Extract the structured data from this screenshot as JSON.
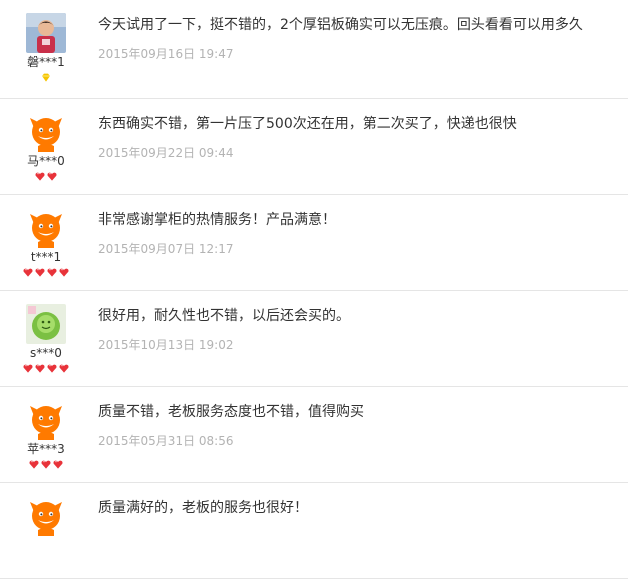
{
  "reviews": [
    {
      "user": "磐***1",
      "avatar": "photo-child-avatar",
      "text": "今天试用了一下，挺不错的，2个厚铝板确实可以无压痕。回头看看可以用多久",
      "date": "2015年09月16日 19:47",
      "badge_type": "diamond",
      "badge_count": 1,
      "badge_color": "#f5c400"
    },
    {
      "user": "马***0",
      "avatar": "taobao-mascot-avatar",
      "text": "东西确实不错，第一片压了500次还在用，第二次买了，快递也很快",
      "date": "2015年09月22日 09:44",
      "badge_type": "heart",
      "badge_count": 2,
      "badge_color": "#e8333a"
    },
    {
      "user": "t***1",
      "avatar": "taobao-mascot-avatar",
      "text": "非常感谢掌柜的热情服务！产品满意！",
      "date": "2015年09月07日 12:17",
      "badge_type": "heart",
      "badge_count": 4,
      "badge_color": "#e8333a"
    },
    {
      "user": "s***0",
      "avatar": "photo-green-avatar",
      "text": "很好用，耐久性也不错，以后还会买的。",
      "date": "2015年10月13日 19:02",
      "badge_type": "heart",
      "badge_count": 4,
      "badge_color": "#e8333a"
    },
    {
      "user": "苹***3",
      "avatar": "taobao-mascot-avatar",
      "text": "质量不错，老板服务态度也不错，值得购买",
      "date": "2015年05月31日 08:56",
      "badge_type": "heart",
      "badge_count": 3,
      "badge_color": "#e8333a"
    },
    {
      "user": "",
      "avatar": "taobao-mascot-avatar",
      "text": "质量满好的，老板的服务也很好！",
      "date": "",
      "badge_type": "heart",
      "badge_count": 0,
      "badge_color": "#e8333a"
    }
  ]
}
